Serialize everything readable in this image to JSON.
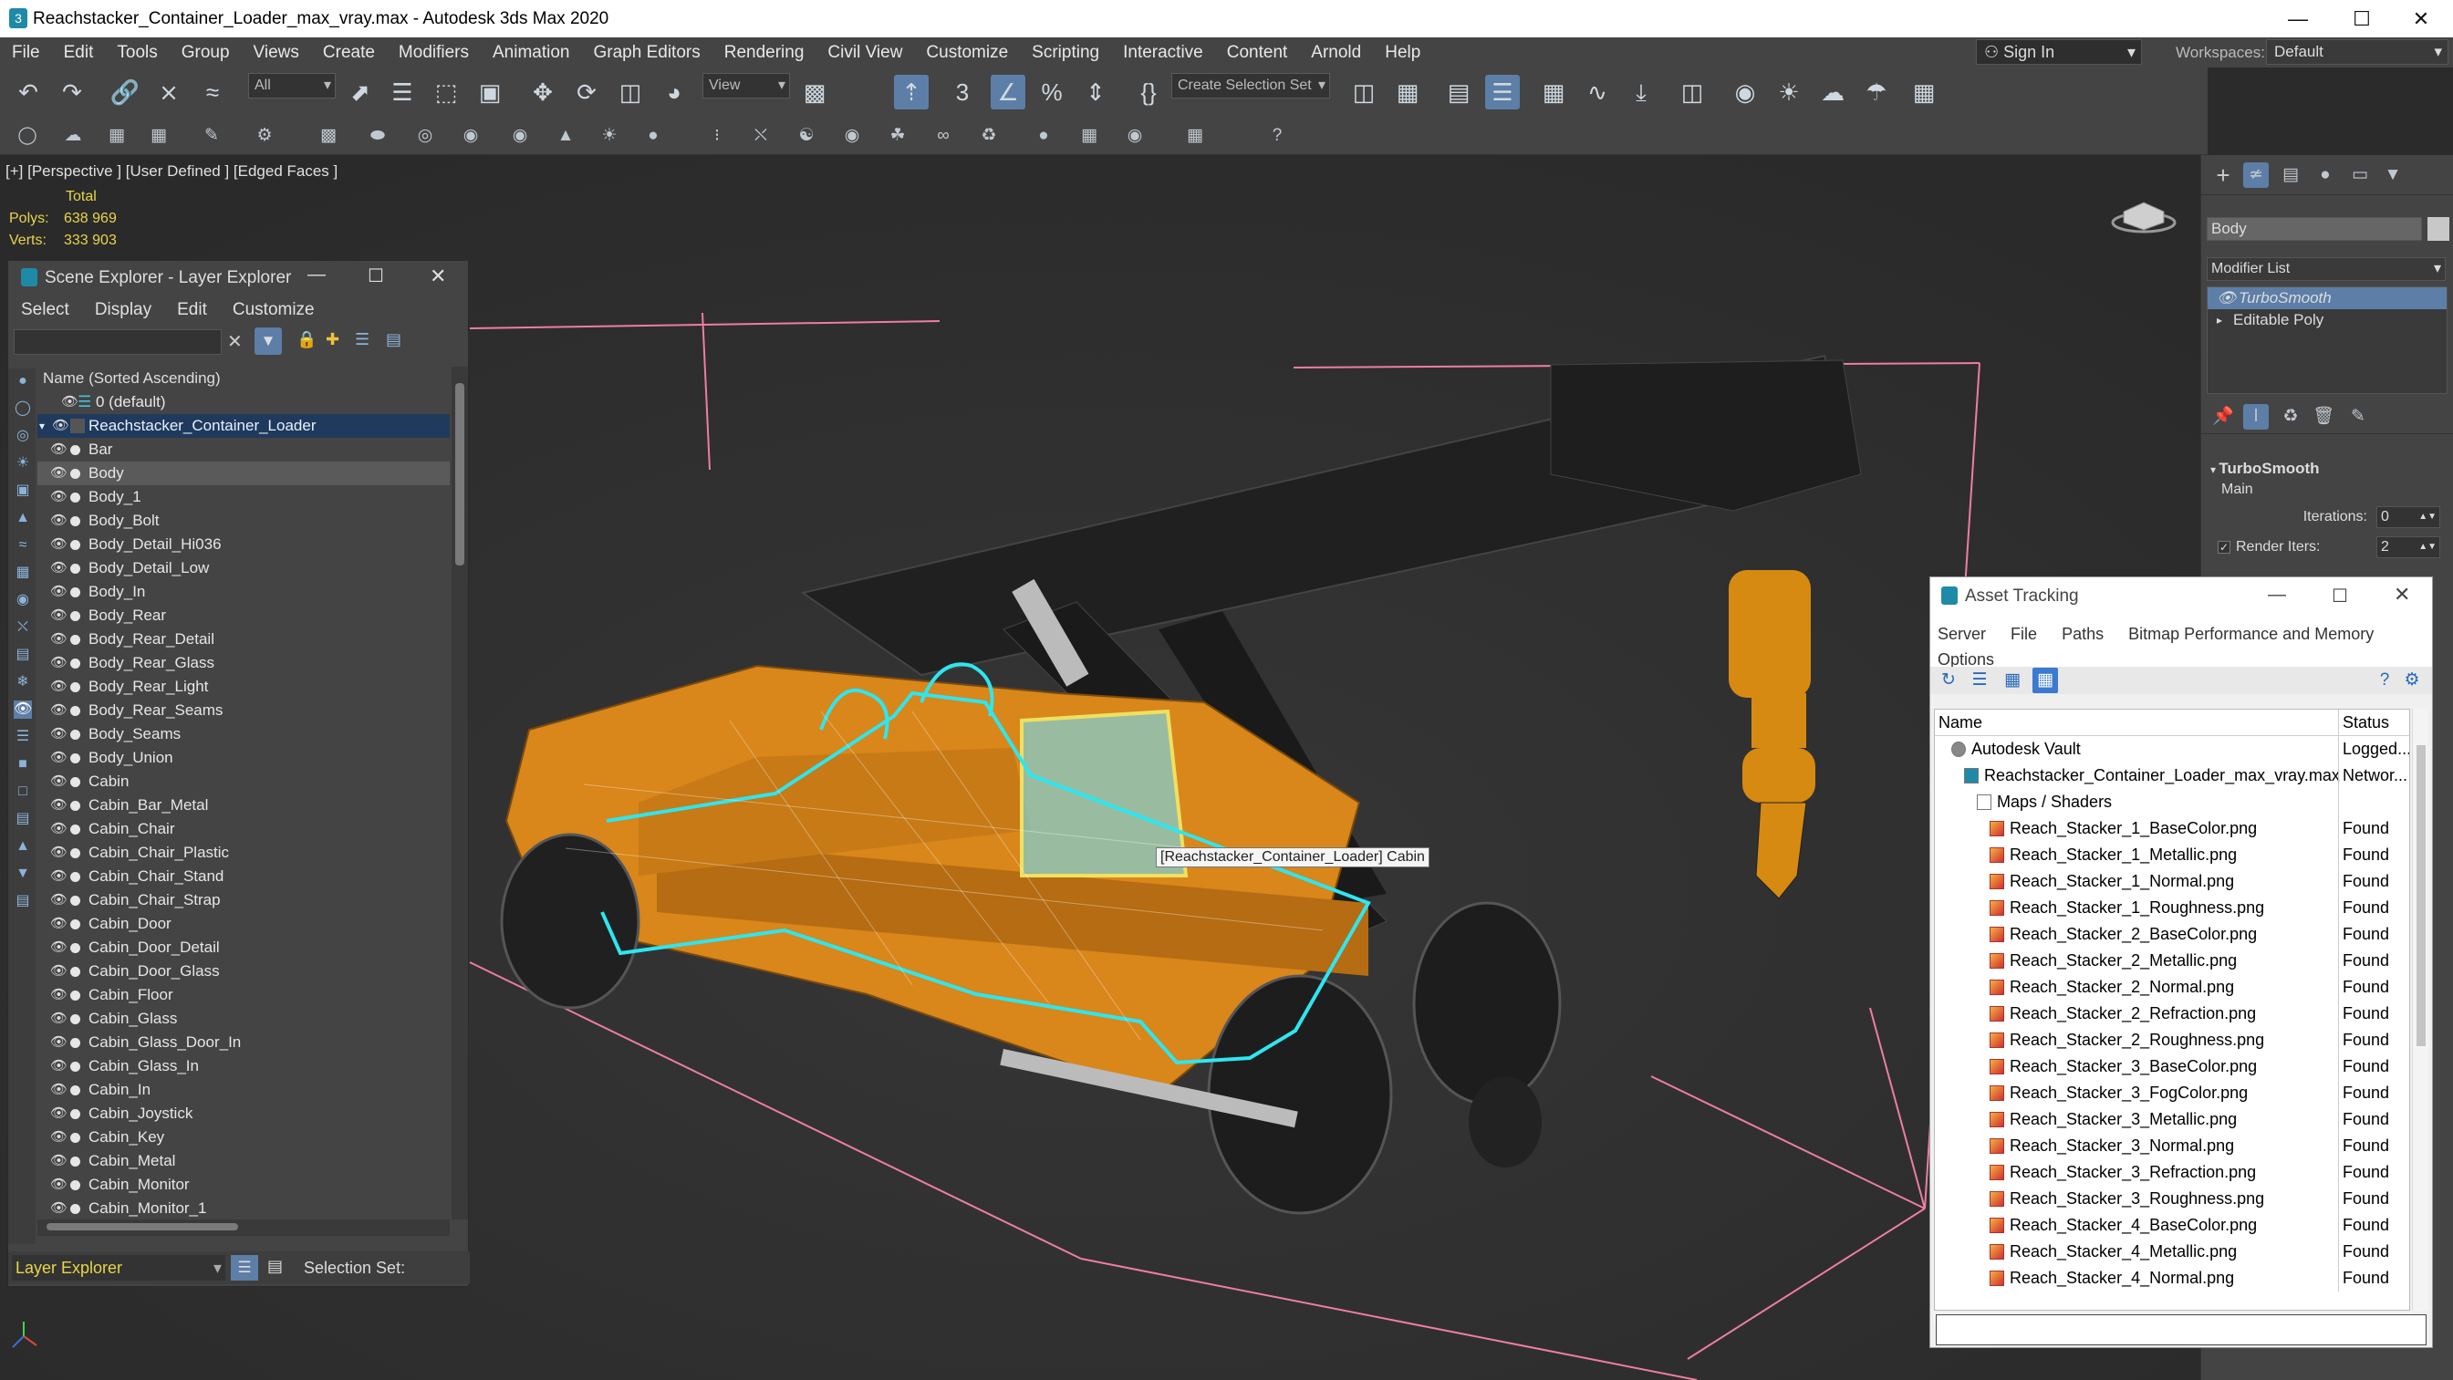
{
  "window": {
    "title": "Reachstacker_Container_Loader_max_vray.max - Autodesk 3ds Max 2020"
  },
  "menu": [
    "File",
    "Edit",
    "Tools",
    "Group",
    "Views",
    "Create",
    "Modifiers",
    "Animation",
    "Graph Editors",
    "Rendering",
    "Civil View",
    "Customize",
    "Scripting",
    "Interactive",
    "Content",
    "Arnold",
    "Help"
  ],
  "account": {
    "sign_in": "Sign In",
    "workspaces_label": "Workspaces:",
    "workspace": "Default"
  },
  "toolbar": {
    "selection_filter": "All",
    "ref_coord": "View",
    "selection_set": "Create Selection Set"
  },
  "viewport": {
    "label": "[+] [Perspective ] [User Defined ] [Edged Faces ]",
    "stats": {
      "header": "Total",
      "polys_label": "Polys:",
      "polys": "638 969",
      "verts_label": "Verts:",
      "verts": "333 903"
    },
    "tooltip": "[Reachstacker_Container_Loader] Cabin"
  },
  "scene_explorer": {
    "title": "Scene Explorer - Layer Explorer",
    "menu": [
      "Select",
      "Display",
      "Edit",
      "Customize"
    ],
    "column_header": "Name (Sorted Ascending)",
    "layer_default": "0 (default)",
    "parent": "Reachstacker_Container_Loader",
    "items": [
      "Bar",
      "Body",
      "Body_1",
      "Body_Bolt",
      "Body_Detail_Hi036",
      "Body_Detail_Low",
      "Body_In",
      "Body_Rear",
      "Body_Rear_Detail",
      "Body_Rear_Glass",
      "Body_Rear_Light",
      "Body_Rear_Seams",
      "Body_Seams",
      "Body_Union",
      "Cabin",
      "Cabin_Bar_Metal",
      "Cabin_Chair",
      "Cabin_Chair_Plastic",
      "Cabin_Chair_Stand",
      "Cabin_Chair_Strap",
      "Cabin_Door",
      "Cabin_Door_Detail",
      "Cabin_Door_Glass",
      "Cabin_Floor",
      "Cabin_Glass",
      "Cabin_Glass_Door_In",
      "Cabin_Glass_In",
      "Cabin_In",
      "Cabin_Joystick",
      "Cabin_Key",
      "Cabin_Metal",
      "Cabin_Monitor",
      "Cabin_Monitor_1"
    ],
    "selected_item": "Body",
    "footer_mode": "Layer Explorer",
    "footer_selection_label": "Selection Set:"
  },
  "command_panel": {
    "object_name": "Body",
    "modifier_list": "Modifier List",
    "stack": [
      "TurboSmooth",
      "Editable Poly"
    ],
    "rollout_title": "TurboSmooth",
    "group": "Main",
    "iterations_label": "Iterations:",
    "iterations": "0",
    "render_iters_label": "Render Iters:",
    "render_iters": "2"
  },
  "asset_tracking": {
    "title": "Asset Tracking",
    "menu": [
      "Server",
      "File",
      "Paths",
      "Bitmap Performance and Memory",
      "Options"
    ],
    "col_name": "Name",
    "col_status": "Status",
    "rows": [
      {
        "name": "Autodesk Vault",
        "status": "Logged...",
        "indent": 1,
        "icon": "vault"
      },
      {
        "name": "Reachstacker_Container_Loader_max_vray.max",
        "status": "Networ...",
        "indent": 2,
        "icon": "max"
      },
      {
        "name": "Maps / Shaders",
        "status": "",
        "indent": 3,
        "icon": "folder"
      },
      {
        "name": "Reach_Stacker_1_BaseColor.png",
        "status": "Found",
        "indent": 4,
        "icon": "bitmap"
      },
      {
        "name": "Reach_Stacker_1_Metallic.png",
        "status": "Found",
        "indent": 4,
        "icon": "bitmap"
      },
      {
        "name": "Reach_Stacker_1_Normal.png",
        "status": "Found",
        "indent": 4,
        "icon": "bitmap"
      },
      {
        "name": "Reach_Stacker_1_Roughness.png",
        "status": "Found",
        "indent": 4,
        "icon": "bitmap"
      },
      {
        "name": "Reach_Stacker_2_BaseColor.png",
        "status": "Found",
        "indent": 4,
        "icon": "bitmap"
      },
      {
        "name": "Reach_Stacker_2_Metallic.png",
        "status": "Found",
        "indent": 4,
        "icon": "bitmap"
      },
      {
        "name": "Reach_Stacker_2_Normal.png",
        "status": "Found",
        "indent": 4,
        "icon": "bitmap"
      },
      {
        "name": "Reach_Stacker_2_Refraction.png",
        "status": "Found",
        "indent": 4,
        "icon": "bitmap"
      },
      {
        "name": "Reach_Stacker_2_Roughness.png",
        "status": "Found",
        "indent": 4,
        "icon": "bitmap"
      },
      {
        "name": "Reach_Stacker_3_BaseColor.png",
        "status": "Found",
        "indent": 4,
        "icon": "bitmap"
      },
      {
        "name": "Reach_Stacker_3_FogColor.png",
        "status": "Found",
        "indent": 4,
        "icon": "bitmap"
      },
      {
        "name": "Reach_Stacker_3_Metallic.png",
        "status": "Found",
        "indent": 4,
        "icon": "bitmap"
      },
      {
        "name": "Reach_Stacker_3_Normal.png",
        "status": "Found",
        "indent": 4,
        "icon": "bitmap"
      },
      {
        "name": "Reach_Stacker_3_Refraction.png",
        "status": "Found",
        "indent": 4,
        "icon": "bitmap"
      },
      {
        "name": "Reach_Stacker_3_Roughness.png",
        "status": "Found",
        "indent": 4,
        "icon": "bitmap"
      },
      {
        "name": "Reach_Stacker_4_BaseColor.png",
        "status": "Found",
        "indent": 4,
        "icon": "bitmap"
      },
      {
        "name": "Reach_Stacker_4_Metallic.png",
        "status": "Found",
        "indent": 4,
        "icon": "bitmap"
      },
      {
        "name": "Reach_Stacker_4_Normal.png",
        "status": "Found",
        "indent": 4,
        "icon": "bitmap"
      }
    ]
  },
  "colors": {
    "accent": "#5d7ea6",
    "selection": "#1f3a5c",
    "stats": "#e8d44a",
    "object_orange": "#d9861a",
    "cyan_select": "#2ee6f0"
  }
}
